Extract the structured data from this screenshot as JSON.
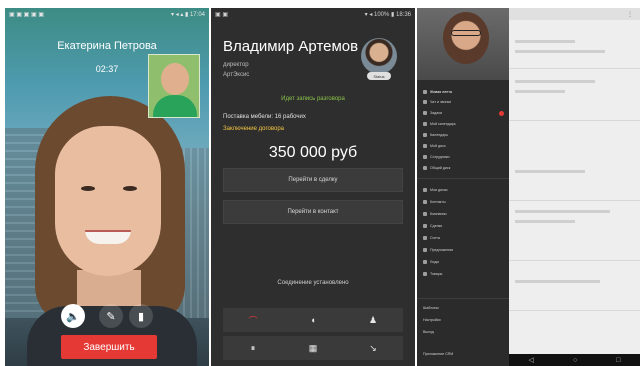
{
  "panel_call": {
    "status_left": "▣ ▣ ▣ ▣ ▣",
    "status_right": "▾ ◂ ▴ ▮ 17:04",
    "caller_name": "Екатерина Петрова",
    "call_time": "02:37",
    "controls": [
      {
        "name": "speaker",
        "glyph": "🔈",
        "active": true
      },
      {
        "name": "mute",
        "glyph": "✎",
        "active": false
      },
      {
        "name": "video",
        "glyph": "▮",
        "active": false
      }
    ],
    "end_label": "Завершить",
    "end_color": "#e53935"
  },
  "panel_crm": {
    "status_left": "▣ ▣",
    "status_right": "▾ ◂ 100% ▮ 18:36",
    "name": "Владимир Артемов",
    "role": "директор",
    "company": "АртЭксис",
    "avatar_badge": "Status",
    "recording_status": "Идет запись разговора",
    "deal_title": "Поставка мебели: 16 рабочих",
    "deal_stage": "Заключение договора",
    "deal_amount": "350 000 руб",
    "deal_button": "Перейти в сделку",
    "contact_button": "Перейти в контакт",
    "connection_status": "Соединение установлено",
    "toolbar_top": [
      "⌒",
      "◖",
      "♟"
    ],
    "toolbar_bottom": [
      "⏸",
      "▦",
      "↘"
    ],
    "accent_green": "#8bc34a",
    "accent_yellow": "#f5c542",
    "hangup_color": "#e53935"
  },
  "panel_menu": {
    "menu_items": [
      "Живая лента",
      "Чат и звонки",
      "Задачи",
      "Мой календарь",
      "Календарь",
      "Мой диск",
      "Сотрудники",
      "Общий диск",
      "Мои диски",
      "Контакты",
      "Компании",
      "Сделки",
      "Счета",
      "Предложения",
      "Лиды",
      "Товары",
      "Шаблоны",
      "Настройки",
      "Выход"
    ],
    "footer_text": "Приложение CRM",
    "nav": [
      "◁",
      "○",
      "□"
    ]
  }
}
